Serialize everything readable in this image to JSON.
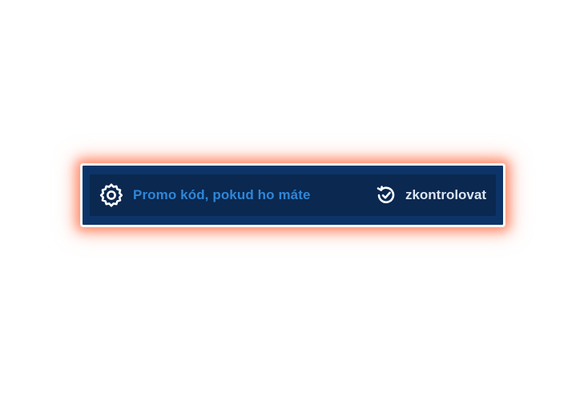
{
  "promo": {
    "placeholder": "Promo kód, pokud ho máte",
    "field_icon": "gear-icon",
    "check_label": "zkontrolovat",
    "check_icon": "refresh-check-icon"
  },
  "colors": {
    "panel": "#0c3468",
    "inner": "#0a2850",
    "placeholder": "#2f86d6",
    "button_text": "#dbe6f2",
    "glow": "#ff6e46"
  }
}
